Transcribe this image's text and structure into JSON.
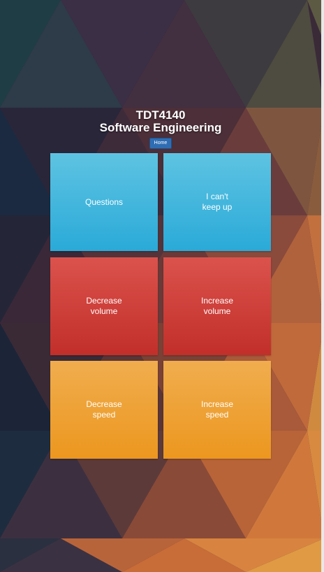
{
  "header": {
    "course_code": "TDT4140",
    "course_name": "Software Engineering",
    "home_label": "Home"
  },
  "tiles": [
    {
      "label": "Questions",
      "color": "#3bb5de"
    },
    {
      "label": "I can't\nkeep up",
      "color": "#3bb5de"
    },
    {
      "label": "Decrease\nvolume",
      "color": "#d2413c"
    },
    {
      "label": "Increase\nvolume",
      "color": "#d2413c"
    },
    {
      "label": "Decrease\nspeed",
      "color": "#eea23a"
    },
    {
      "label": "Increase\nspeed",
      "color": "#eea23a"
    }
  ]
}
